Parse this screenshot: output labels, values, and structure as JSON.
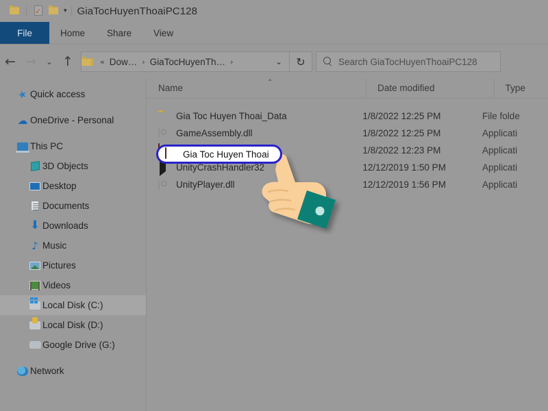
{
  "window": {
    "title": "GiaTocHuyenThoaiPC128",
    "quick_access_toolbar": [
      {
        "name": "folder-icon",
        "label": ""
      },
      {
        "name": "properties-icon",
        "label": ""
      },
      {
        "name": "new-folder-icon",
        "label": ""
      },
      {
        "name": "customize-dropdown-icon",
        "label": "▾"
      }
    ]
  },
  "ribbon": {
    "tabs": [
      {
        "label": "File",
        "active": true
      },
      {
        "label": "Home",
        "active": false
      },
      {
        "label": "Share",
        "active": false
      },
      {
        "label": "View",
        "active": false
      }
    ]
  },
  "navbar": {
    "back": "←",
    "forward": "→",
    "recent": "⌄",
    "up": "↑",
    "breadcrumbs": [
      {
        "label": "«",
        "type": "overflow"
      },
      {
        "label": "Dow…",
        "type": "crumb"
      },
      {
        "label": "GiaTocHuyenTh…",
        "type": "crumb"
      }
    ],
    "separator": "›",
    "dropdown": "⌄",
    "refresh": "↻"
  },
  "search": {
    "placeholder": "Search GiaTocHuyenThoaiPC128",
    "icon": "search-icon"
  },
  "sidebar": {
    "items": [
      {
        "label": "Quick access",
        "icon": "star-icon",
        "indent": 0,
        "selected": false,
        "gap_before": false
      },
      {
        "label": "OneDrive - Personal",
        "icon": "cloud-icon",
        "indent": 0,
        "selected": false,
        "gap_before": true
      },
      {
        "label": "This PC",
        "icon": "pc-icon",
        "indent": 0,
        "selected": false,
        "gap_before": true
      },
      {
        "label": "3D Objects",
        "icon": "3d-objects-icon",
        "indent": 1,
        "selected": false,
        "gap_before": false
      },
      {
        "label": "Desktop",
        "icon": "desktop-icon",
        "indent": 1,
        "selected": false,
        "gap_before": false
      },
      {
        "label": "Documents",
        "icon": "documents-icon",
        "indent": 1,
        "selected": false,
        "gap_before": false
      },
      {
        "label": "Downloads",
        "icon": "downloads-icon",
        "indent": 1,
        "selected": false,
        "gap_before": false
      },
      {
        "label": "Music",
        "icon": "music-icon",
        "indent": 1,
        "selected": false,
        "gap_before": false
      },
      {
        "label": "Pictures",
        "icon": "pictures-icon",
        "indent": 1,
        "selected": false,
        "gap_before": false
      },
      {
        "label": "Videos",
        "icon": "videos-icon",
        "indent": 1,
        "selected": false,
        "gap_before": false
      },
      {
        "label": "Local Disk (C:)",
        "icon": "local-disk-c-icon",
        "indent": 1,
        "selected": true,
        "gap_before": false
      },
      {
        "label": "Local Disk (D:)",
        "icon": "local-disk-d-icon",
        "indent": 1,
        "selected": false,
        "gap_before": false
      },
      {
        "label": "Google Drive (G:)",
        "icon": "google-drive-icon",
        "indent": 1,
        "selected": false,
        "gap_before": false
      },
      {
        "label": "Network",
        "icon": "network-icon",
        "indent": 0,
        "selected": false,
        "gap_before": true
      }
    ]
  },
  "filelist": {
    "columns": [
      {
        "label": "Name",
        "sorted": "asc",
        "sort_glyph": "⌃"
      },
      {
        "label": "Date modified",
        "sorted": "",
        "sort_glyph": ""
      },
      {
        "label": "Type",
        "sorted": "",
        "sort_glyph": ""
      }
    ],
    "rows": [
      {
        "name": "Gia Toc Huyen Thoai_Data",
        "date": "1/8/2022 12:25 PM",
        "type": "File folde",
        "icon": "folder-icon",
        "selected": false
      },
      {
        "name": "GameAssembly.dll",
        "date": "1/8/2022 12:25 PM",
        "type": "Applicati",
        "icon": "dll-file-icon",
        "selected": false
      },
      {
        "name": "Gia Toc Huyen Thoai",
        "date": "1/8/2022 12:23 PM",
        "type": "Applicati",
        "icon": "game-app-icon",
        "selected": true
      },
      {
        "name": "UnityCrashHandler32",
        "date": "12/12/2019 1:50 PM",
        "type": "Applicati",
        "icon": "unity-icon",
        "selected": false
      },
      {
        "name": "UnityPlayer.dll",
        "date": "12/12/2019 1:56 PM",
        "type": "Applicati",
        "icon": "dll-file-icon",
        "selected": false
      }
    ]
  },
  "annotation": {
    "highlight_shape": "oval",
    "highlight_color": "#2822c8",
    "highlight_target": "Gia Toc Huyen Thoai",
    "cursor": "pointing-hand-cursor",
    "cursor_skin_color": "#f7c98f",
    "cursor_cuff_color": "#0f8076"
  },
  "colors": {
    "window_background": "#9a9a9a",
    "file_tab_blue": "#134a7c",
    "folder_yellow": "#d3b45c"
  }
}
